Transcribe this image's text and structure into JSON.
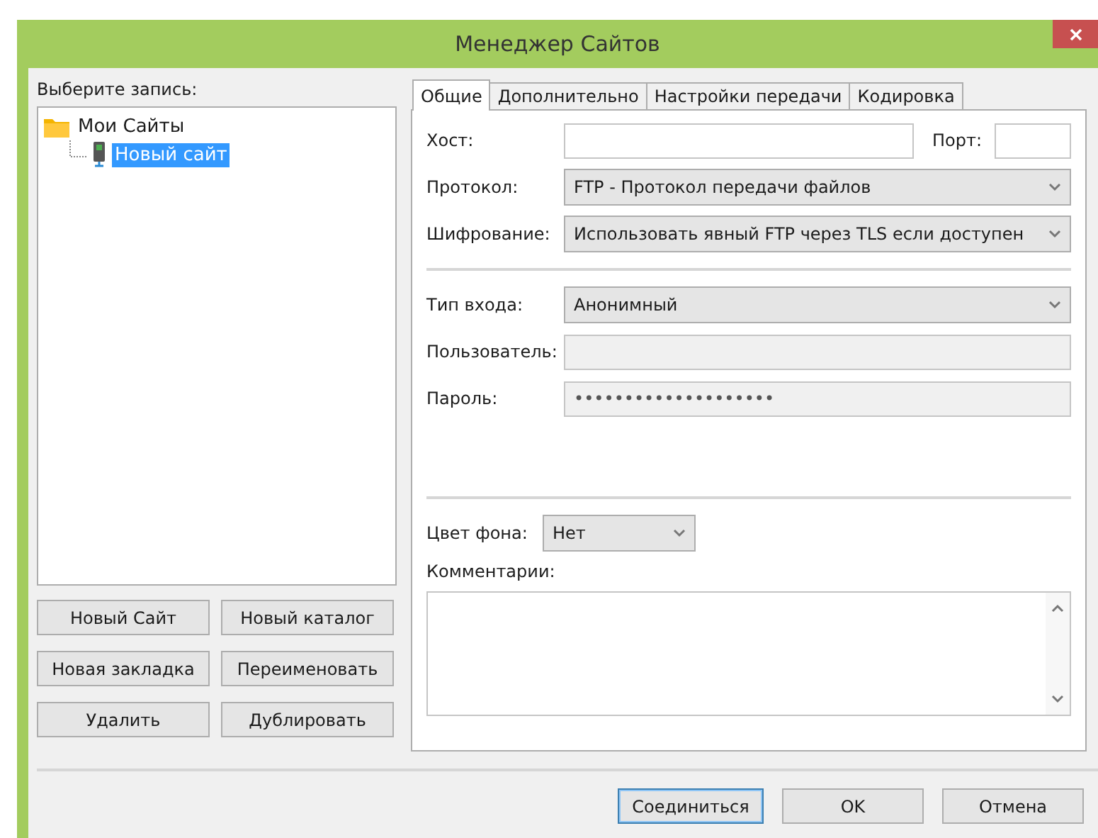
{
  "window": {
    "title": "Менеджер Сайтов"
  },
  "tree": {
    "label": "Выберите запись:",
    "items": [
      {
        "label": "Мои Сайты",
        "kind": "folder",
        "selected": false,
        "children": [
          {
            "label": "Новый сайт",
            "kind": "site",
            "selected": true
          }
        ]
      }
    ]
  },
  "left_buttons": [
    "Новый Сайт",
    "Новый каталог",
    "Новая закладка",
    "Переименовать",
    "Удалить",
    "Дублировать"
  ],
  "tabs": [
    {
      "label": "Общие",
      "selected": true
    },
    {
      "label": "Дополнительно",
      "selected": false
    },
    {
      "label": "Настройки передачи",
      "selected": false
    },
    {
      "label": "Кодировка",
      "selected": false
    }
  ],
  "general": {
    "host_label": "Хост:",
    "port_label": "Порт:",
    "protocol_label": "Протокол:",
    "protocol": "FTP - Протокол передачи файлов",
    "encryption_label": "Шифрование:",
    "encryption": "Использовать явный FTP через TLS если доступен",
    "logon_label": "Тип входа:",
    "logon": "Анонимный",
    "user_label": "Пользователь:",
    "user_disabled": true,
    "password_label": "Пароль:",
    "password": "••••••••••••••••••••",
    "password_disabled": true,
    "bg_label": "Цвет фона:",
    "bg": "Нет",
    "comments_label": "Комментарии:"
  },
  "bottom_buttons": [
    {
      "label": "Соединиться",
      "default": true
    },
    {
      "label": "OK",
      "default": false
    },
    {
      "label": "Отмена",
      "default": false
    }
  ]
}
